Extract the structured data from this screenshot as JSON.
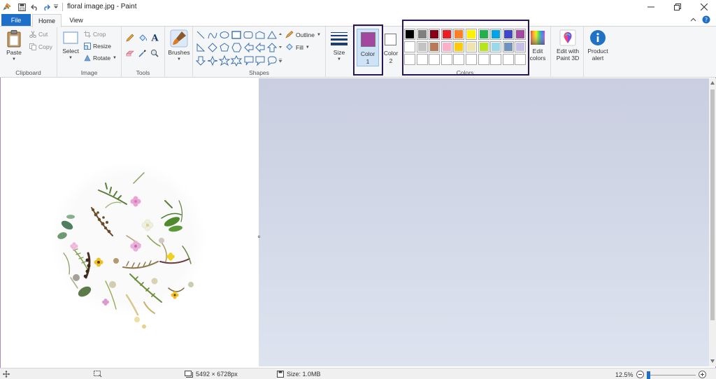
{
  "window": {
    "title": "floral image.jpg - Paint"
  },
  "tabs": [
    {
      "label": "File"
    },
    {
      "label": "Home"
    },
    {
      "label": "View"
    }
  ],
  "clipboard": {
    "group_label": "Clipboard",
    "paste": "Paste",
    "cut": "Cut",
    "copy": "Copy"
  },
  "image": {
    "group_label": "Image",
    "select": "Select",
    "crop": "Crop",
    "resize": "Resize",
    "rotate": "Rotate"
  },
  "tools": {
    "group_label": "Tools"
  },
  "brushes": {
    "label": "Brushes"
  },
  "shapes": {
    "group_label": "Shapes",
    "outline": "Outline",
    "fill": "Fill"
  },
  "size": {
    "label": "Size"
  },
  "color1": {
    "label_line1": "Color",
    "label_line2": "1",
    "value": "#a347a0"
  },
  "color2": {
    "label_line1": "Color",
    "label_line2": "2",
    "value": "#ffffff"
  },
  "colors": {
    "group_label": "Colors",
    "row1": [
      "#000000",
      "#7f7f7f",
      "#880015",
      "#ed1c24",
      "#ff7f27",
      "#fff200",
      "#22b14c",
      "#00a2e8",
      "#3f48cc",
      "#a349a4"
    ],
    "row2": [
      "#ffffff",
      "#c3c3c3",
      "#b97a57",
      "#ffaec9",
      "#ffc90e",
      "#efe4b0",
      "#b5e61d",
      "#99d9ea",
      "#7092be",
      "#c8bfe7"
    ],
    "row3": [
      "#ffffff",
      "#ffffff",
      "#ffffff",
      "#ffffff",
      "#ffffff",
      "#ffffff",
      "#ffffff",
      "#ffffff",
      "#ffffff",
      "#ffffff"
    ]
  },
  "edit_colors": {
    "line1": "Edit",
    "line2": "colors"
  },
  "paint3d": {
    "line1": "Edit with",
    "line2": "Paint 3D"
  },
  "product_alert": {
    "line1": "Product",
    "line2": "alert"
  },
  "status": {
    "dimensions": "5492 × 6728px",
    "size": "Size: 1.0MB",
    "zoom": "12.5%",
    "zoom_fraction": 0.125
  }
}
